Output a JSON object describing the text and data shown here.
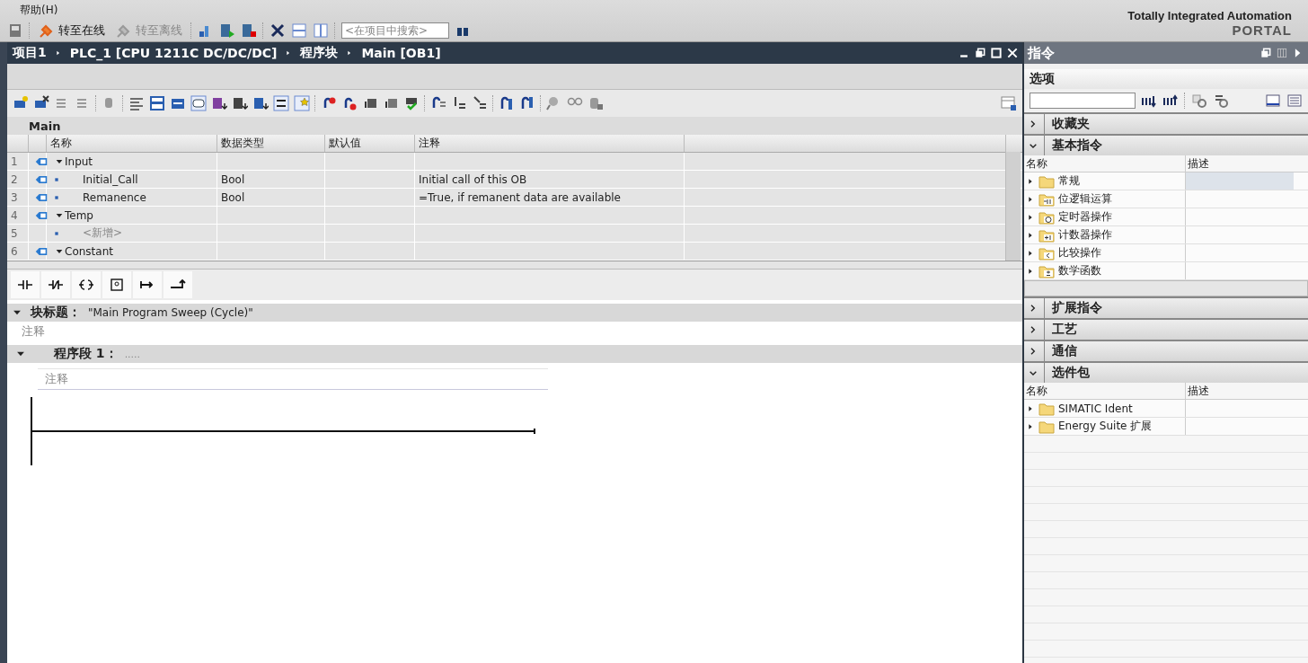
{
  "menu": {
    "items": [
      "帮助(H)"
    ]
  },
  "toolbar": {
    "buttons": [
      {
        "label": "转至在线",
        "disabled": false
      },
      {
        "label": "转至离线",
        "disabled": true
      }
    ],
    "search": {
      "placeholder": "<在项目中搜索>"
    }
  },
  "brand": {
    "line1": "Totally Integrated Automation",
    "line2": "PORTAL"
  },
  "editor": {
    "breadcrumb": [
      "项目1",
      "PLC_1 [CPU 1211C DC/DC/DC]",
      "程序块",
      "Main [OB1]"
    ],
    "interface": {
      "title": "Main",
      "columns": [
        "名称",
        "数据类型",
        "默认值",
        "注释"
      ],
      "rows": [
        {
          "num": "1",
          "kind": "section",
          "name": "Input",
          "expanded": true,
          "children": [
            {
              "num": "2",
              "kind": "var",
              "name": "Initial_Call",
              "type": "Bool",
              "comment": "Initial call of this OB"
            },
            {
              "num": "3",
              "kind": "var",
              "name": "Remanence",
              "type": "Bool",
              "comment": "=True, if remanent data are available"
            }
          ]
        },
        {
          "num": "4",
          "kind": "section",
          "name": "Temp",
          "expanded": true,
          "children": [
            {
              "num": "5",
              "kind": "add",
              "name": "<新增>"
            }
          ]
        },
        {
          "num": "6",
          "kind": "section",
          "name": "Constant",
          "expanded": true
        }
      ]
    },
    "block_title": {
      "label": "块标题：",
      "value": "\"Main Program Sweep (Cycle)\"",
      "expanded": true,
      "comment": {
        "placeholder": "注释"
      }
    },
    "network": {
      "label": "程序段 1：",
      "title": ".....",
      "expanded": true,
      "comment": {
        "placeholder": "注释"
      }
    }
  },
  "instructions": {
    "title": "指令",
    "options": "选项",
    "sections": [
      {
        "title": "收藏夹",
        "expanded": false
      },
      {
        "title": "基本指令",
        "expanded": true,
        "columns": [
          "名称",
          "描述"
        ],
        "items": [
          {
            "name": "常规",
            "kind": "folder",
            "selected": true
          },
          {
            "name": "位逻辑运算",
            "kind": "bit",
            "selected": false
          },
          {
            "name": "定时器操作",
            "kind": "timer",
            "selected": false
          },
          {
            "name": "计数器操作",
            "kind": "counter",
            "selected": false
          },
          {
            "name": "比较操作",
            "kind": "compare",
            "selected": false
          },
          {
            "name": "数学函数",
            "kind": "math",
            "selected": false
          }
        ]
      },
      {
        "title": "扩展指令",
        "expanded": false
      },
      {
        "title": "工艺",
        "expanded": false
      },
      {
        "title": "通信",
        "expanded": false
      },
      {
        "title": "选件包",
        "expanded": true,
        "columns": [
          "名称",
          "描述"
        ],
        "items": [
          {
            "name": "SIMATIC Ident",
            "kind": "folder",
            "selected": false
          },
          {
            "name": "Energy Suite 扩展",
            "kind": "folder",
            "selected": false
          }
        ]
      }
    ]
  }
}
